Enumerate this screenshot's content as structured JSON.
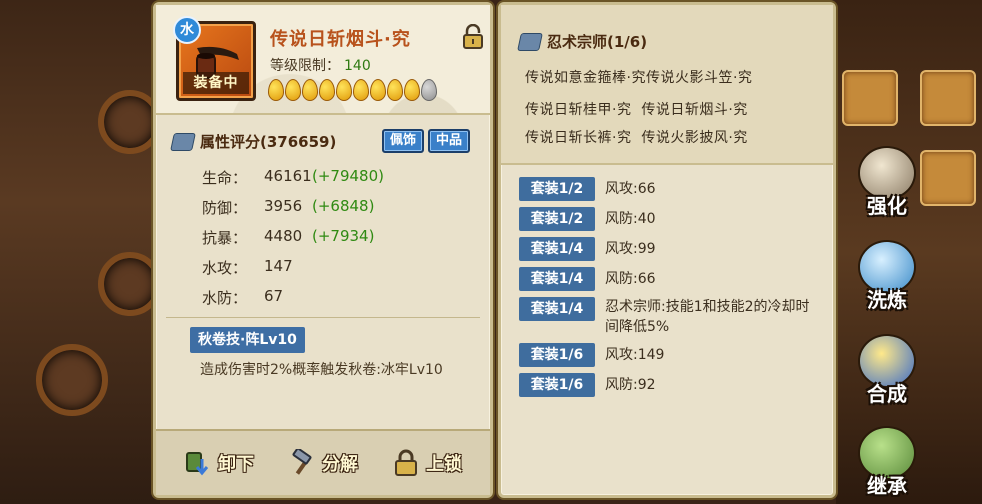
{
  "item": {
    "element_badge": "水",
    "name": "传说日斩烟斗·究",
    "equipped_label": "装备中",
    "level_label": "等级限制：",
    "level_value": "140",
    "stars_filled": 9,
    "stars_total": 10
  },
  "attributes": {
    "header": "属性评分(376659)",
    "tag_type": "佩饰",
    "tag_grade": "中品",
    "stats": [
      {
        "label": "生命：",
        "value": "46161",
        "bonus": "(+79480)"
      },
      {
        "label": "防御：",
        "value": "3956",
        "bonus": "(+6848)"
      },
      {
        "label": "抗暴：",
        "value": "4480",
        "bonus": "(+7934)"
      },
      {
        "label": "水攻：",
        "value": "147",
        "bonus": ""
      },
      {
        "label": "水防：",
        "value": "67",
        "bonus": ""
      }
    ]
  },
  "skill": {
    "name": "秋卷技·阵Lv10",
    "desc": "造成伤害时2%概率触发秋卷:冰牢Lv10"
  },
  "actions": {
    "unequip": "卸下",
    "decompose": "分解",
    "lock": "上锁"
  },
  "set": {
    "header": "忍术宗师(1/6)",
    "pieces": [
      [
        "传说如意金箍棒·究",
        "传说火影斗笠·究"
      ],
      [
        "传说日斩桂甲·究",
        "传说日斩烟斗·究"
      ],
      [
        "传说日斩长裤·究",
        "传说火影披风·究"
      ]
    ],
    "bonuses": [
      {
        "tier": "套装1/2",
        "effect": "风攻:66"
      },
      {
        "tier": "套装1/2",
        "effect": "风防:40"
      },
      {
        "tier": "套装1/4",
        "effect": "风攻:99"
      },
      {
        "tier": "套装1/4",
        "effect": "风防:66"
      },
      {
        "tier": "套装1/4",
        "effect": "忍术宗师:技能1和技能2的冷却时间降低5%"
      },
      {
        "tier": "套装1/6",
        "effect": "风攻:149"
      },
      {
        "tier": "套装1/6",
        "effect": "风防:92"
      }
    ]
  },
  "side_buttons": {
    "enhance": "强化",
    "refine": "洗炼",
    "synthesize": "合成",
    "inherit": "继承"
  },
  "colors": {
    "panel_bg": "#e9e1cb",
    "accent_blue": "#3f6d9e",
    "bonus_green": "#2f8a12",
    "item_name": "#b8521c"
  }
}
